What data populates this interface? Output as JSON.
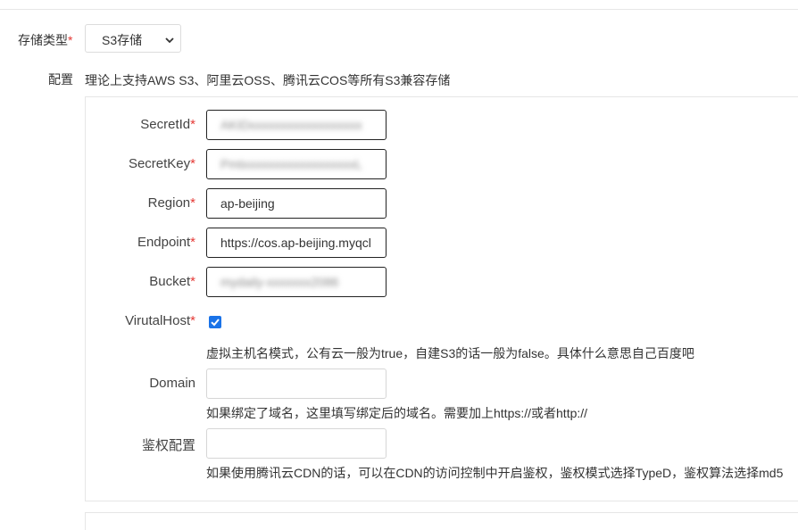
{
  "storage_type": {
    "label": "存储类型",
    "required_mark": "*",
    "selected": "S3存储"
  },
  "config": {
    "label": "配置",
    "description": "理论上支持AWS S3、阿里云OSS、腾讯云COS等所有S3兼容存储"
  },
  "fields": {
    "secret_id": {
      "label": "SecretId",
      "required_mark": "*",
      "value": "AKIDxxxxxxxxxxxxxxxxxx"
    },
    "secret_key": {
      "label": "SecretKey",
      "required_mark": "*",
      "value": "PmtxxxxxxxxxxxxxxxxxxL"
    },
    "region": {
      "label": "Region",
      "required_mark": "*",
      "value": "ap-beijing"
    },
    "endpoint": {
      "label": "Endpoint",
      "required_mark": "*",
      "value": "https://cos.ap-beijing.myqcl"
    },
    "bucket": {
      "label": "Bucket",
      "required_mark": "*",
      "value": "mydaily-xxxxxxx2086"
    },
    "virtual_host": {
      "label": "VirutalHost",
      "required_mark": "*",
      "checked": true,
      "help": "虚拟主机名模式，公有云一般为true，自建S3的话一般为false。具体什么意思自己百度吧"
    },
    "domain": {
      "label": "Domain",
      "value": "",
      "help": "如果绑定了域名，这里填写绑定后的域名。需要加上https://或者http://"
    },
    "auth_config": {
      "label": "鉴权配置",
      "value": "",
      "help": "如果使用腾讯云CDN的话，可以在CDN的访问控制中开启鉴权，鉴权模式选择TypeD，鉴权算法选择md5"
    }
  },
  "colors": {
    "accent": "#1a73e8",
    "required": "#e53935"
  },
  "icons": {
    "select_arrow": "chevron-down-icon",
    "checkbox": "check-icon"
  }
}
